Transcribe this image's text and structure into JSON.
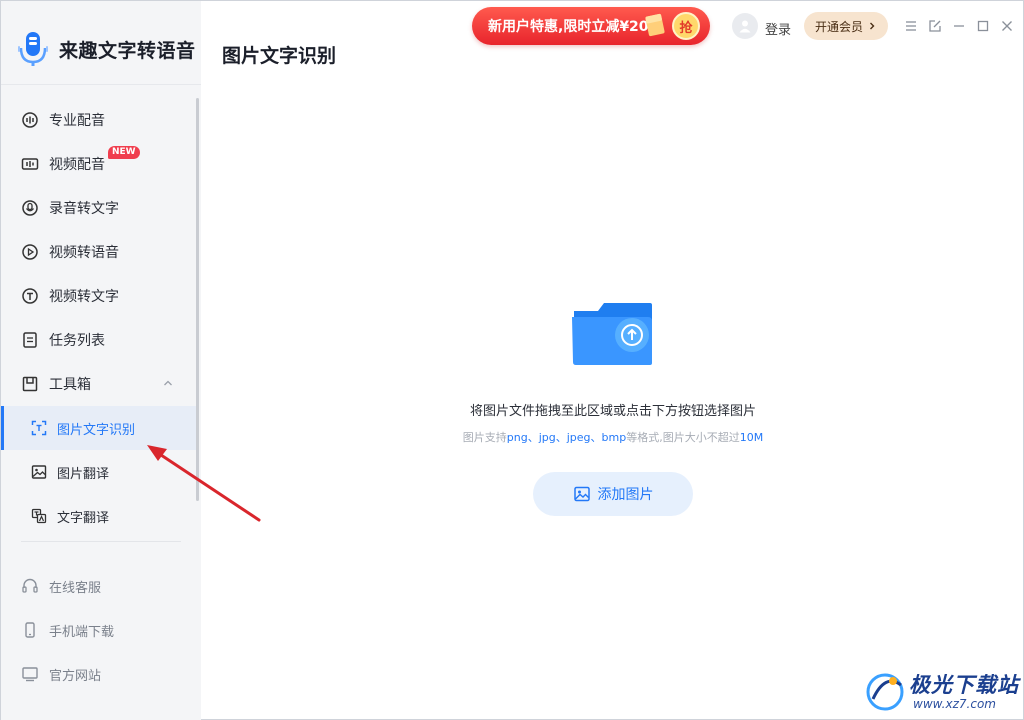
{
  "app": {
    "name": "来趣文字转语音"
  },
  "sidebar": {
    "items": [
      {
        "label": "专业配音",
        "icon": "pro-dubbing-icon"
      },
      {
        "label": "视频配音",
        "icon": "video-dubbing-icon",
        "badge": "NEW"
      },
      {
        "label": "录音转文字",
        "icon": "record-to-text-icon"
      },
      {
        "label": "视频转语音",
        "icon": "video-to-audio-icon"
      },
      {
        "label": "视频转文字",
        "icon": "video-to-text-icon"
      },
      {
        "label": "任务列表",
        "icon": "task-list-icon"
      },
      {
        "label": "工具箱",
        "icon": "toolbox-icon",
        "expanded": true
      }
    ],
    "tools": [
      {
        "label": "图片文字识别",
        "icon": "ocr-scan-icon",
        "active": true
      },
      {
        "label": "图片翻译",
        "icon": "image-icon"
      },
      {
        "label": "文字翻译",
        "icon": "text-translate-icon"
      }
    ],
    "footer": [
      {
        "label": "在线客服",
        "icon": "headset-icon"
      },
      {
        "label": "手机端下载",
        "icon": "phone-icon"
      },
      {
        "label": "官方网站",
        "icon": "monitor-icon"
      }
    ]
  },
  "topbar": {
    "promo_text": "新用户特惠,限时立减¥200",
    "promo_button": "抢",
    "login_label": "登录",
    "vip_label": "开通会员"
  },
  "main": {
    "title": "图片文字识别",
    "drop_hint": "将图片文件拖拽至此区域或点击下方按钮选择图片",
    "formats_prefix": "图片支持",
    "formats": "png、jpg、jpeg、bmp",
    "formats_mid": "等格式,图片大小不超过",
    "size_limit": "10M",
    "add_button": "添加图片"
  },
  "watermark": {
    "name": "极光下载站",
    "url": "www.xz7.com"
  },
  "colors": {
    "accent": "#2378f7",
    "sidebar_bg": "#f4f5f7",
    "promo_red": "#e8242c",
    "vip_gold": "#f7e4cf",
    "arrow_red": "#d9262c"
  }
}
